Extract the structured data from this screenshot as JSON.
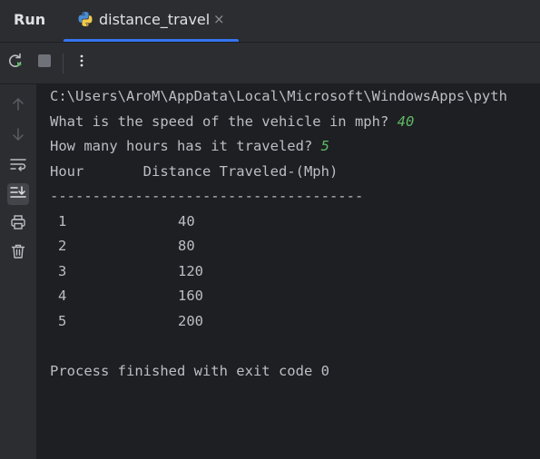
{
  "header": {
    "run_title": "Run",
    "tab": {
      "label": "distance_travel",
      "icon": "python-icon",
      "close_glyph": "×"
    }
  },
  "toolbar": {
    "buttons": [
      {
        "name": "rerun-button",
        "icon": "rerun-icon"
      },
      {
        "name": "stop-button",
        "icon": "stop-icon"
      },
      {
        "name": "more-options-button",
        "icon": "vertical-dots-icon"
      }
    ]
  },
  "gutter": {
    "buttons": [
      {
        "name": "scroll-up-button",
        "icon": "arrow-up-icon"
      },
      {
        "name": "scroll-down-button",
        "icon": "arrow-down-icon"
      },
      {
        "name": "soft-wrap-button",
        "icon": "soft-wrap-icon"
      },
      {
        "name": "scroll-to-end-button",
        "icon": "scroll-to-end-icon",
        "active": true
      },
      {
        "name": "print-button",
        "icon": "printer-icon"
      },
      {
        "name": "clear-all-button",
        "icon": "trash-icon"
      }
    ]
  },
  "console": {
    "path_line": "C:\\Users\\AroM\\AppData\\Local\\Microsoft\\WindowsApps\\pyth",
    "prompt_speed": "What is the speed of the vehicle in mph? ",
    "input_speed": "40",
    "prompt_hours": "How many hours has it traveled? ",
    "input_hours": "5",
    "table_header": "Hour       Distance Traveled-(Mph)",
    "separator": "-------------------------------------",
    "rows": [
      {
        "hour": "1",
        "distance": "40"
      },
      {
        "hour": "2",
        "distance": "80"
      },
      {
        "hour": "3",
        "distance": "120"
      },
      {
        "hour": "4",
        "distance": "160"
      },
      {
        "hour": "5",
        "distance": "200"
      }
    ],
    "exit_message": "Process finished with exit code 0"
  },
  "colors": {
    "background": "#1e1f22",
    "panel": "#2b2d30",
    "text": "#bcbec4",
    "input_text": "#5fb865",
    "accent": "#3574f0",
    "rerun_green": "#5fb865"
  }
}
